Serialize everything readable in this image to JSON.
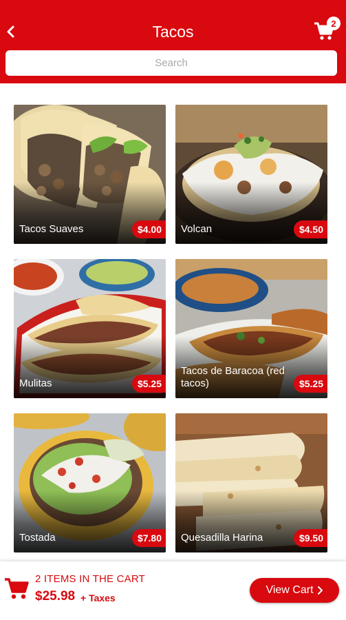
{
  "header": {
    "title": "Tacos",
    "back_icon": "chevron-left-icon",
    "cart_icon": "cart-icon",
    "cart_badge": "2",
    "color": "#d8090f"
  },
  "search": {
    "placeholder": "Search",
    "value": ""
  },
  "products": [
    {
      "name": "Tacos Suaves",
      "price": "$4.00"
    },
    {
      "name": "Volcan",
      "price": "$4.50"
    },
    {
      "name": "Mulitas",
      "price": "$5.25"
    },
    {
      "name": "Tacos de Baracoa (red tacos)",
      "price": "$5.25"
    },
    {
      "name": "Tostada",
      "price": "$7.80"
    },
    {
      "name": "Quesadilla Harina",
      "price": "$9.50"
    }
  ],
  "cart_bar": {
    "count_text": "2 ITEMS IN THE CART",
    "total": "$25.98",
    "taxes": "+ Taxes",
    "button_label": "View Cart",
    "button_icon": "chevron-right-icon"
  }
}
